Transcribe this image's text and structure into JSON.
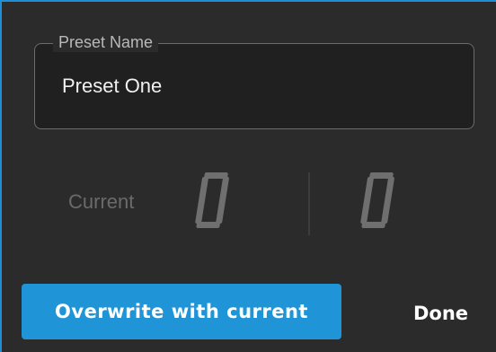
{
  "preset": {
    "label": "Preset Name",
    "value": "Preset One"
  },
  "current": {
    "label": "Current",
    "left_digit": "0",
    "right_digit": "0"
  },
  "actions": {
    "overwrite_label": "Overwrite with current",
    "done_label": "Done"
  },
  "colors": {
    "accent": "#1f95d8",
    "background": "#2b2b2b",
    "field_background": "#202020"
  }
}
